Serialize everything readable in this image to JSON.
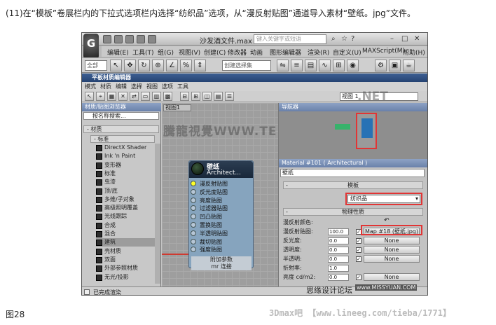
{
  "caption": "(11)在“模板”卷展栏内的下拉式选项栏内选择“纺织品”选项，从“漫反射贴图”通道导入素材“壁纸。jpg”文件。",
  "figure_label": "图28",
  "credit": "3Dmax吧 【www.lineeg.com/tieba/1771】",
  "app": {
    "logo": "G",
    "doc_title": "沙发酒文件.max",
    "search_placeholder": "键入关键字或短语",
    "menu": [
      "编辑(E)",
      "工具(T)",
      "组(G)",
      "视图(V)",
      "创建(C)",
      "修改器",
      "动画",
      "图形编辑器",
      "渲染(R)",
      "自定义(U)",
      "MAXScript(M)",
      "帮助(H)"
    ],
    "toolbar": {
      "filter_value": "全部",
      "selection_set_placeholder": "创建选择集"
    }
  },
  "editor": {
    "title": "平板材质编辑器",
    "menu": [
      "模式",
      "材质",
      "编辑",
      "选择",
      "视图",
      "选项",
      "工具"
    ],
    "view_select": "视图 1",
    "browser": {
      "header": "材质/贴图浏览器",
      "search": "按名称搜索...",
      "category": "- 材质",
      "subcategory": "- 标准",
      "items": [
        "DirectX Shader",
        "Ink 'n Paint",
        "变形器",
        "标准",
        "虫漆",
        "顶/底",
        "多维/子对象",
        "高级照明覆盖",
        "光线跟踪",
        "合成",
        "混合",
        "建筑",
        "壳材质",
        "双面",
        "外部参照材质",
        "无光/投影"
      ],
      "selected_index": 11
    },
    "view_tab": "视图1",
    "watermark": "騰龍視覺WWW.TENG",
    "nav_header": "导航器",
    "nav_watermark": ".NET",
    "node": {
      "name": "壁纸",
      "type": "Architect...",
      "slots": [
        "漫反射贴图",
        "反光度贴图",
        "亮度贴图",
        "过滤器贴图",
        "凹凸贴图",
        "置换贴图",
        "半透明贴图",
        "裁切贴图",
        "强度贴图"
      ],
      "active_slot": 0,
      "foot1": "附加参数",
      "foot2": "mr 连接"
    },
    "props": {
      "header": "Material #101 ( Architectural )",
      "name": "壁纸",
      "rollout_template": "模板",
      "template_value": "纺织品",
      "rollout_physical": "物理性质",
      "rows": [
        {
          "label": "漫反射颜色:",
          "value": "",
          "check": "",
          "map": ""
        },
        {
          "label": "漫反射贴图:",
          "value": "100.0",
          "check": "✓",
          "map": "Map #18 (壁纸.jpg)"
        },
        {
          "label": "反光度:",
          "value": "0.0",
          "check": "✓",
          "map": "None"
        },
        {
          "label": "透明度:",
          "value": "0.0",
          "check": "✓",
          "map": "None"
        },
        {
          "label": "半透明:",
          "value": "0.0",
          "check": "✓",
          "map": "None"
        },
        {
          "label": "折射率:",
          "value": "1.0",
          "check": "",
          "map": ""
        },
        {
          "label": "亮度 cd/m2:",
          "value": "0.0",
          "check": "✓",
          "map": "None"
        }
      ]
    },
    "status": "已完成渲染",
    "status_watermark": "思缘设计论坛",
    "status_url": "www.MISSYUAN.COM"
  }
}
